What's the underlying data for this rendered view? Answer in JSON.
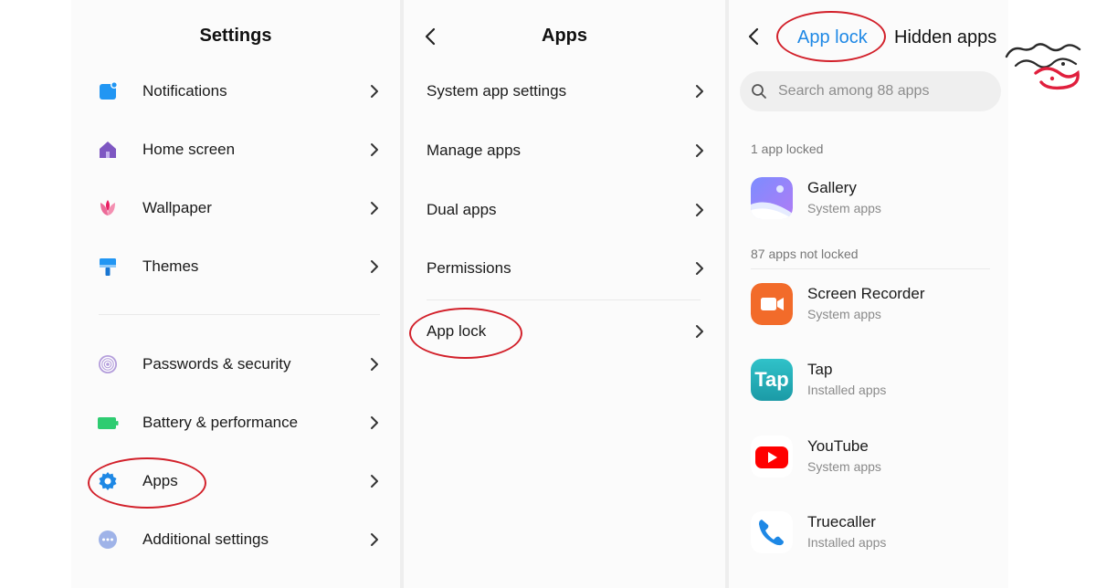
{
  "settings": {
    "title": "Settings",
    "items": [
      {
        "label": "Notifications",
        "icon": "notifications-icon"
      },
      {
        "label": "Home screen",
        "icon": "home-icon"
      },
      {
        "label": "Wallpaper",
        "icon": "wallpaper-icon"
      },
      {
        "label": "Themes",
        "icon": "themes-icon"
      },
      {
        "label": "Passwords & security",
        "icon": "fingerprint-icon"
      },
      {
        "label": "Battery & performance",
        "icon": "battery-icon"
      },
      {
        "label": "Apps",
        "icon": "gear-icon"
      },
      {
        "label": "Additional settings",
        "icon": "more-icon"
      }
    ]
  },
  "apps_menu": {
    "title": "Apps",
    "items": [
      {
        "label": "System app settings"
      },
      {
        "label": "Manage apps"
      },
      {
        "label": "Dual apps"
      },
      {
        "label": "Permissions"
      },
      {
        "label": "App lock"
      }
    ]
  },
  "app_lock": {
    "tabs": [
      {
        "label": "App lock",
        "active": true
      },
      {
        "label": "Hidden apps",
        "active": false
      }
    ],
    "search_placeholder": "Search among 88 apps",
    "locked_header": "1 app locked",
    "not_locked_header": "87 apps not locked",
    "locked_apps": [
      {
        "name": "Gallery",
        "type": "System apps",
        "icon": "gallery-icon"
      }
    ],
    "unlocked_apps": [
      {
        "name": "Screen Recorder",
        "type": "System apps",
        "icon": "screen-recorder-icon"
      },
      {
        "name": "Tap",
        "type": "Installed apps",
        "icon": "tap-icon",
        "icon_text": "Tap"
      },
      {
        "name": "YouTube",
        "type": "System apps",
        "icon": "youtube-icon"
      },
      {
        "name": "Truecaller",
        "type": "Installed apps",
        "icon": "phone-icon"
      }
    ]
  },
  "colors": {
    "accent": "#1e88e5",
    "highlight": "#d2202a",
    "watermark_red": "#e01f3d"
  }
}
